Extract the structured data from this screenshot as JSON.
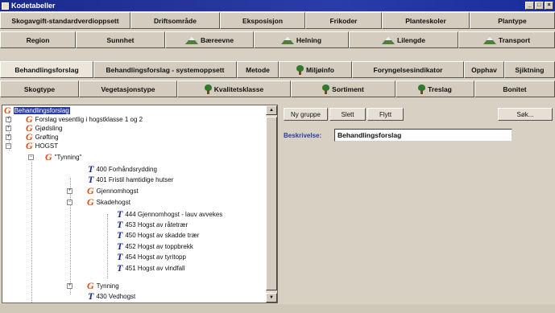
{
  "window": {
    "title": "Kodetabeller",
    "buttons": [
      "_",
      "□",
      "×"
    ]
  },
  "tabs": {
    "row1": [
      "Skogavgift-standardverdioppsett",
      "Driftsområde",
      "Eksposisjon",
      "Frikoder",
      "Planteskoler",
      "Plantype"
    ],
    "row2": [
      "Region",
      "Sunnhet",
      "Bæreevne",
      "Helning",
      "Lilengde",
      "Transport"
    ],
    "row3": [
      "Behandlingsforslag",
      "Behandlingsforslag - systemoppsett",
      "Metode",
      "Miljøinfo",
      "Foryngelsesindikator",
      "Opphav",
      "Sjiktning"
    ],
    "row4": [
      "Skogtype",
      "Vegetasjonstype",
      "Kvalitetsklasse",
      "Sortiment",
      "Treslag",
      "Bonitet"
    ],
    "active": "Behandlingsforslag",
    "icons": {
      "Bæreevne": "mountain-icon",
      "Helning": "mountain-icon",
      "Lilengde": "mountain-icon",
      "Transport": "mountain-icon",
      "Miljøinfo": "tree-icon",
      "Kvalitetsklasse": "tree-icon",
      "Sortiment": "tree-icon",
      "Treslag": "tree-icon"
    }
  },
  "tree": {
    "root": "Behandlingsforslag",
    "items": [
      {
        "glyph": "G",
        "expander": "+",
        "label": "Forslag vesentlig i hogstklasse 1 og 2"
      },
      {
        "glyph": "G",
        "expander": "+",
        "label": "Gjødsling"
      },
      {
        "glyph": "G",
        "expander": "+",
        "label": "Grøfting"
      },
      {
        "glyph": "G",
        "expander": "−",
        "label": "HOGST"
      },
      {
        "glyph": "G",
        "expander": "−",
        "label": "\"Tynning\""
      },
      {
        "glyph": "T",
        "expander": "",
        "label": "400 Forhåndsrydding"
      },
      {
        "glyph": "T",
        "expander": "",
        "label": "401 Fristil hamtidige hutser"
      },
      {
        "glyph": "G",
        "expander": "+",
        "label": "Gjennomhogst"
      },
      {
        "glyph": "G",
        "expander": "−",
        "label": "Skadehogst"
      },
      {
        "glyph": "T",
        "expander": "",
        "label": "444 Gjennomhogst - lauv avvekes"
      },
      {
        "glyph": "T",
        "expander": "",
        "label": "453 Hogst av råtetrær"
      },
      {
        "glyph": "T",
        "expander": "",
        "label": "450 Hogst av skadde trær"
      },
      {
        "glyph": "T",
        "expander": "",
        "label": "452 Hogst av toppbrekk"
      },
      {
        "glyph": "T",
        "expander": "",
        "label": "454 Hogst av tyritopp"
      },
      {
        "glyph": "T",
        "expander": "",
        "label": "451 Hogst av vindfall"
      },
      {
        "glyph": "G",
        "expander": "+",
        "label": "Tynning"
      },
      {
        "glyph": "T",
        "expander": "",
        "label": "430 Vedhogst"
      }
    ],
    "colors": {
      "group": "#e04a10",
      "type": "#1a2a8c",
      "selection": "#2a3ca8"
    }
  },
  "toolbar": {
    "new_group": "Ny gruppe",
    "delete": "Slett",
    "move": "Flytt",
    "search": "Søk..."
  },
  "detail": {
    "label": "Beskrivelse:",
    "value": "Behandlingsforslag"
  },
  "scrollbar": {
    "up": "▲",
    "down": "▼"
  }
}
